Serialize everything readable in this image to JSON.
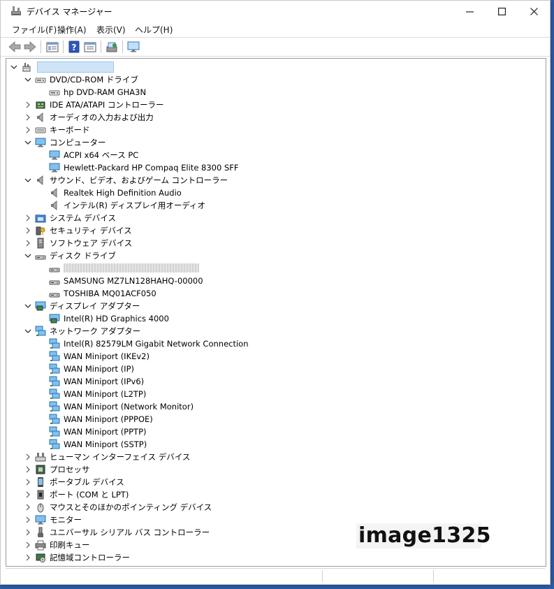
{
  "window": {
    "title": "デバイス マネージャー"
  },
  "menu": [
    "ファイル(F)",
    "操作(A)",
    "表示(V)",
    "ヘルプ(H)"
  ],
  "toolbar": [
    "back-icon",
    "forward-icon",
    "show-hide-tree-icon",
    "help-icon",
    "properties-icon",
    "scan-hardware-icon",
    "monitor-icon"
  ],
  "watermark": "image1325",
  "tree": [
    {
      "label": "",
      "level": 0,
      "state": "open",
      "icon": "computer-root-icon",
      "redacted": true
    },
    {
      "label": "DVD/CD-ROM ドライブ",
      "level": 1,
      "state": "open",
      "icon": "dvd-icon"
    },
    {
      "label": "hp DVD-RAM GHA3N",
      "level": 2,
      "state": "none",
      "icon": "dvd-icon"
    },
    {
      "label": "IDE ATA/ATAPI コントローラー",
      "level": 1,
      "state": "closed",
      "icon": "ide-icon"
    },
    {
      "label": "オーディオの入力および出力",
      "level": 1,
      "state": "closed",
      "icon": "speaker-icon"
    },
    {
      "label": "キーボード",
      "level": 1,
      "state": "closed",
      "icon": "keyboard-icon"
    },
    {
      "label": "コンピューター",
      "level": 1,
      "state": "open",
      "icon": "monitor-icon"
    },
    {
      "label": "ACPI x64 ベース PC",
      "level": 2,
      "state": "none",
      "icon": "monitor-icon"
    },
    {
      "label": "Hewlett-Packard HP Compaq Elite 8300 SFF",
      "level": 2,
      "state": "none",
      "icon": "monitor-icon"
    },
    {
      "label": "サウンド、ビデオ、およびゲーム コントローラー",
      "level": 1,
      "state": "open",
      "icon": "speaker-icon"
    },
    {
      "label": "Realtek High Definition Audio",
      "level": 2,
      "state": "none",
      "icon": "speaker-icon"
    },
    {
      "label": "インテル(R) ディスプレイ用オーディオ",
      "level": 2,
      "state": "none",
      "icon": "speaker-icon"
    },
    {
      "label": "システム デバイス",
      "level": 1,
      "state": "closed",
      "icon": "system-folder-icon"
    },
    {
      "label": "セキュリティ デバイス",
      "level": 1,
      "state": "closed",
      "icon": "key-icon"
    },
    {
      "label": "ソフトウェア デバイス",
      "level": 1,
      "state": "closed",
      "icon": "tower-icon"
    },
    {
      "label": "ディスク ドライブ",
      "level": 1,
      "state": "open",
      "icon": "disk-icon"
    },
    {
      "label": "",
      "level": 2,
      "state": "none",
      "icon": "disk-icon",
      "redacted": true
    },
    {
      "label": "SAMSUNG MZ7LN128HAHQ-00000",
      "level": 2,
      "state": "none",
      "icon": "disk-icon"
    },
    {
      "label": "TOSHIBA MQ01ACF050",
      "level": 2,
      "state": "none",
      "icon": "disk-icon"
    },
    {
      "label": "ディスプレイ アダプター",
      "level": 1,
      "state": "open",
      "icon": "display-adapter-icon"
    },
    {
      "label": "Intel(R) HD Graphics 4000",
      "level": 2,
      "state": "none",
      "icon": "display-adapter-icon"
    },
    {
      "label": "ネットワーク アダプター",
      "level": 1,
      "state": "open",
      "icon": "network-icon"
    },
    {
      "label": "Intel(R) 82579LM Gigabit Network Connection",
      "level": 2,
      "state": "none",
      "icon": "network-icon"
    },
    {
      "label": "WAN Miniport (IKEv2)",
      "level": 2,
      "state": "none",
      "icon": "network-icon"
    },
    {
      "label": "WAN Miniport (IP)",
      "level": 2,
      "state": "none",
      "icon": "network-icon"
    },
    {
      "label": "WAN Miniport (IPv6)",
      "level": 2,
      "state": "none",
      "icon": "network-icon"
    },
    {
      "label": "WAN Miniport (L2TP)",
      "level": 2,
      "state": "none",
      "icon": "network-icon"
    },
    {
      "label": "WAN Miniport (Network Monitor)",
      "level": 2,
      "state": "none",
      "icon": "network-icon"
    },
    {
      "label": "WAN Miniport (PPPOE)",
      "level": 2,
      "state": "none",
      "icon": "network-icon"
    },
    {
      "label": "WAN Miniport (PPTP)",
      "level": 2,
      "state": "none",
      "icon": "network-icon"
    },
    {
      "label": "WAN Miniport (SSTP)",
      "level": 2,
      "state": "none",
      "icon": "network-icon"
    },
    {
      "label": "ヒューマン インターフェイス デバイス",
      "level": 1,
      "state": "closed",
      "icon": "hid-icon"
    },
    {
      "label": "プロセッサ",
      "level": 1,
      "state": "closed",
      "icon": "processor-icon"
    },
    {
      "label": "ポータブル デバイス",
      "level": 1,
      "state": "closed",
      "icon": "portable-device-icon"
    },
    {
      "label": "ポート (COM と LPT)",
      "level": 1,
      "state": "closed",
      "icon": "port-icon"
    },
    {
      "label": "マウスとそのほかのポインティング デバイス",
      "level": 1,
      "state": "closed",
      "icon": "mouse-icon"
    },
    {
      "label": "モニター",
      "level": 1,
      "state": "closed",
      "icon": "monitor-icon"
    },
    {
      "label": "ユニバーサル シリアル バス コントローラー",
      "level": 1,
      "state": "closed",
      "icon": "usb-icon"
    },
    {
      "label": "印刷キュー",
      "level": 1,
      "state": "closed",
      "icon": "printer-icon"
    },
    {
      "label": "記憶域コントローラー",
      "level": 1,
      "state": "closed",
      "icon": "storage-controller-icon"
    }
  ]
}
